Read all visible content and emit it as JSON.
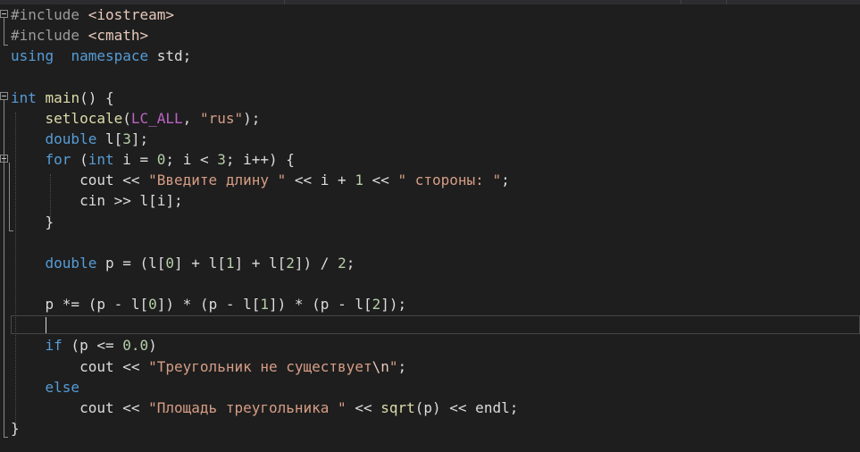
{
  "editor": {
    "lines": [
      {
        "tokens": [
          [
            "pp",
            "#include "
          ],
          [
            "inc",
            "<iostream>"
          ]
        ]
      },
      {
        "tokens": [
          [
            "pp",
            "#include "
          ],
          [
            "inc",
            "<cmath>"
          ]
        ]
      },
      {
        "tokens": [
          [
            "kw",
            "using"
          ],
          [
            "",
            "  "
          ],
          [
            "kw",
            "namespace"
          ],
          [
            "",
            " std;"
          ]
        ]
      },
      {
        "tokens": []
      },
      {
        "tokens": [
          [
            "kw",
            "int"
          ],
          [
            "",
            " "
          ],
          [
            "fn",
            "main"
          ],
          [
            "",
            "() {"
          ]
        ]
      },
      {
        "tokens": [
          [
            "",
            "    "
          ],
          [
            "fn",
            "setlocale"
          ],
          [
            "",
            "("
          ],
          [
            "mac",
            "LC_ALL"
          ],
          [
            "",
            ", "
          ],
          [
            "str",
            "\"rus\""
          ],
          [
            "",
            ");"
          ]
        ]
      },
      {
        "tokens": [
          [
            "",
            "    "
          ],
          [
            "kw",
            "double"
          ],
          [
            "",
            " l["
          ],
          [
            "num",
            "3"
          ],
          [
            "",
            "];"
          ]
        ]
      },
      {
        "tokens": [
          [
            "",
            "    "
          ],
          [
            "kw",
            "for"
          ],
          [
            "",
            " ("
          ],
          [
            "kw",
            "int"
          ],
          [
            "",
            " i = "
          ],
          [
            "num",
            "0"
          ],
          [
            "",
            "; i < "
          ],
          [
            "num",
            "3"
          ],
          [
            "",
            "; i++) {"
          ]
        ]
      },
      {
        "tokens": [
          [
            "",
            "        cout << "
          ],
          [
            "str",
            "\"Введите длину \""
          ],
          [
            "",
            " << i + "
          ],
          [
            "num",
            "1"
          ],
          [
            "",
            " << "
          ],
          [
            "str",
            "\" стороны: \""
          ],
          [
            "",
            ";"
          ]
        ]
      },
      {
        "tokens": [
          [
            "",
            "        cin >> l[i];"
          ]
        ]
      },
      {
        "tokens": [
          [
            "",
            "    }"
          ]
        ]
      },
      {
        "tokens": []
      },
      {
        "tokens": [
          [
            "",
            "    "
          ],
          [
            "kw",
            "double"
          ],
          [
            "",
            " p = (l["
          ],
          [
            "num",
            "0"
          ],
          [
            "",
            "] + l["
          ],
          [
            "num",
            "1"
          ],
          [
            "",
            "] + l["
          ],
          [
            "num",
            "2"
          ],
          [
            "",
            "]) / "
          ],
          [
            "num",
            "2"
          ],
          [
            "",
            ";"
          ]
        ]
      },
      {
        "tokens": []
      },
      {
        "tokens": [
          [
            "",
            "    p *= (p - l["
          ],
          [
            "num",
            "0"
          ],
          [
            "",
            "]) * (p - l["
          ],
          [
            "num",
            "1"
          ],
          [
            "",
            "]) * (p - l["
          ],
          [
            "num",
            "2"
          ],
          [
            "",
            "]);"
          ]
        ]
      },
      {
        "tokens": []
      },
      {
        "tokens": [
          [
            "",
            "    "
          ],
          [
            "kw",
            "if"
          ],
          [
            "",
            " (p <= "
          ],
          [
            "num",
            "0.0"
          ],
          [
            "",
            ")"
          ]
        ]
      },
      {
        "tokens": [
          [
            "",
            "        cout << "
          ],
          [
            "str",
            "\"Треугольник не существует"
          ],
          [
            "esc",
            "\\n"
          ],
          [
            "str",
            "\""
          ],
          [
            "",
            ";"
          ]
        ]
      },
      {
        "tokens": [
          [
            "",
            "    "
          ],
          [
            "kw",
            "else"
          ]
        ]
      },
      {
        "tokens": [
          [
            "",
            "        cout << "
          ],
          [
            "str",
            "\"Площадь треугольника \""
          ],
          [
            "",
            " << "
          ],
          [
            "fn",
            "sqrt"
          ],
          [
            "",
            "(p) << endl;"
          ]
        ]
      },
      {
        "tokens": [
          [
            "",
            "}"
          ]
        ]
      }
    ]
  }
}
